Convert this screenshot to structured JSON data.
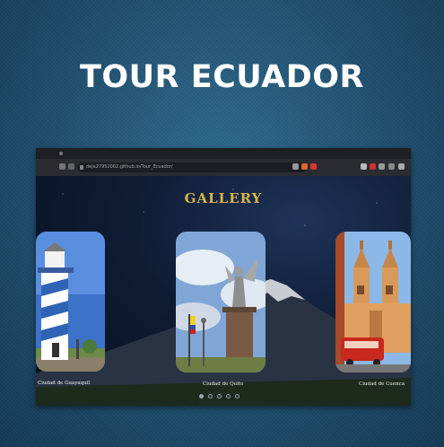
{
  "page": {
    "title": "TOUR ECUADOR"
  },
  "browser": {
    "url": "deja27952002.github.io/Tour_Ecuador/"
  },
  "gallery": {
    "heading": "GALLERY",
    "cards": [
      {
        "caption": "Ciudad de Guayaquil",
        "image": "lighthouse"
      },
      {
        "caption": "Ciudad de Quito",
        "image": "virgin-statue"
      },
      {
        "caption": "Ciudad de Cuenca",
        "image": "cathedral"
      }
    ],
    "pagination": {
      "count": 5,
      "active_index": 0
    }
  },
  "colors": {
    "gallery_heading": "#d8b547",
    "background": "#1f4f6e"
  }
}
